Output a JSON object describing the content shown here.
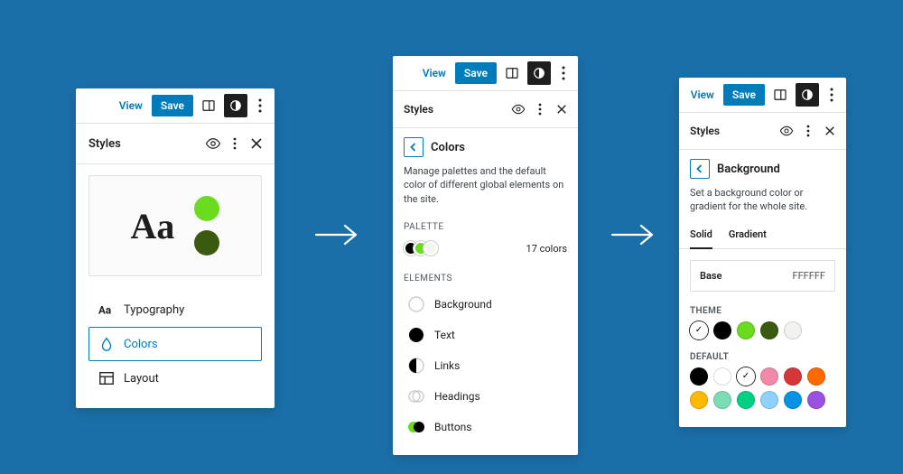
{
  "toolbar": {
    "view": "View",
    "save": "Save"
  },
  "styles_title": "Styles",
  "panel1": {
    "preview_text": "Aa",
    "items": [
      {
        "label": "Typography"
      },
      {
        "label": "Colors"
      },
      {
        "label": "Layout"
      }
    ]
  },
  "panel2": {
    "title": "Colors",
    "description": "Manage palettes and the default color of different global elements on the site.",
    "palette_label": "PALETTE",
    "palette_count": "17 colors",
    "palette_swatches": [
      "#000000",
      "#6bdb1f",
      "#f5f5f0"
    ],
    "elements_label": "ELEMENTS",
    "elements": [
      {
        "label": "Background"
      },
      {
        "label": "Text"
      },
      {
        "label": "Links"
      },
      {
        "label": "Headings"
      },
      {
        "label": "Buttons"
      }
    ]
  },
  "panel3": {
    "title": "Background",
    "description": "Set a background color or gradient for the whole site.",
    "tabs": [
      "Solid",
      "Gradient"
    ],
    "base_label": "Base",
    "base_value": "FFFFFF",
    "theme_label": "THEME",
    "theme_colors": [
      "#ffffff",
      "#000000",
      "#6bdb1f",
      "#3a5a10",
      "#f2f2f0"
    ],
    "theme_selected": 0,
    "default_label": "DEFAULT",
    "default_colors": [
      "#000000",
      "#ffffff",
      "#ffffff",
      "#f08aa8",
      "#d63638",
      "#ff6900",
      "#fcb900",
      "#7bdcb5",
      "#00d084",
      "#8ed1fc",
      "#0693e3",
      "#9b51e0"
    ],
    "default_selected": 2
  }
}
